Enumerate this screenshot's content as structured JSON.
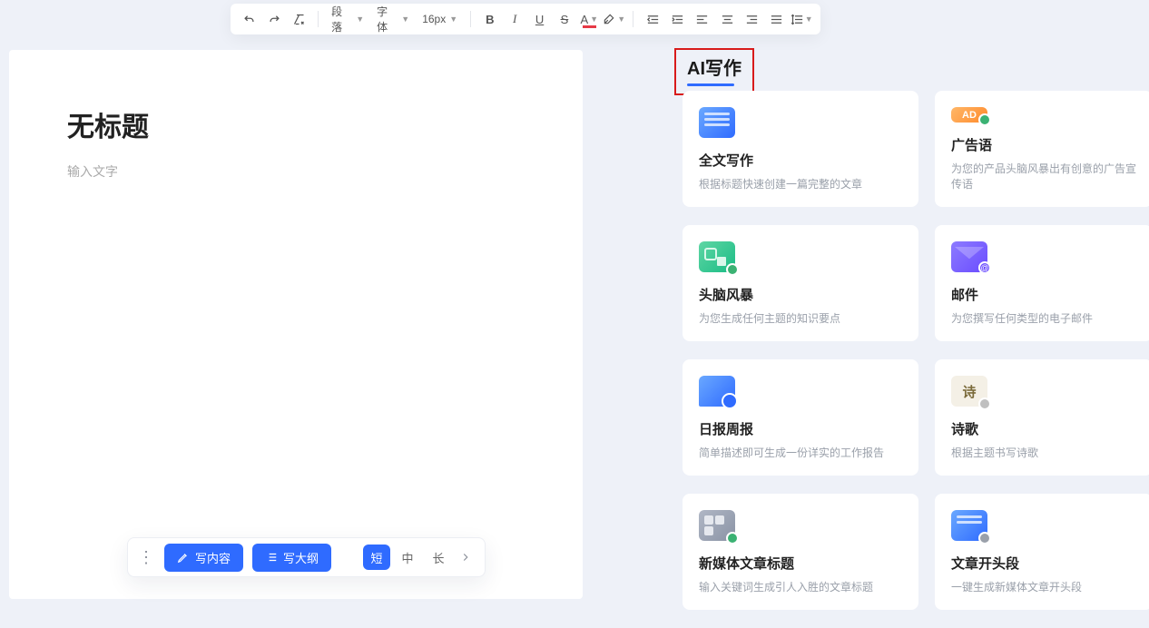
{
  "toolbar": {
    "paragraph": "段落",
    "font": "字体",
    "size": "16px"
  },
  "editor": {
    "title": "无标题",
    "placeholder": "输入文字"
  },
  "bottom": {
    "write_content": "写内容",
    "write_outline": "写大纲",
    "seg_short": "短",
    "seg_mid": "中",
    "seg_long": "长"
  },
  "ai_tab": "AI写作",
  "cards": [
    {
      "title": "全文写作",
      "desc": "根据标题快速创建一篇完整的文章"
    },
    {
      "title": "广告语",
      "desc": "为您的产品头脑风暴出有创意的广告宣传语"
    },
    {
      "title": "头脑风暴",
      "desc": "为您生成任何主题的知识要点"
    },
    {
      "title": "邮件",
      "desc": "为您撰写任何类型的电子邮件"
    },
    {
      "title": "日报周报",
      "desc": "简单描述即可生成一份详实的工作报告"
    },
    {
      "title": "诗歌",
      "desc": "根据主题书写诗歌"
    },
    {
      "title": "新媒体文章标题",
      "desc": "输入关键词生成引人入胜的文章标题"
    },
    {
      "title": "文章开头段",
      "desc": "一键生成新媒体文章开头段"
    }
  ]
}
